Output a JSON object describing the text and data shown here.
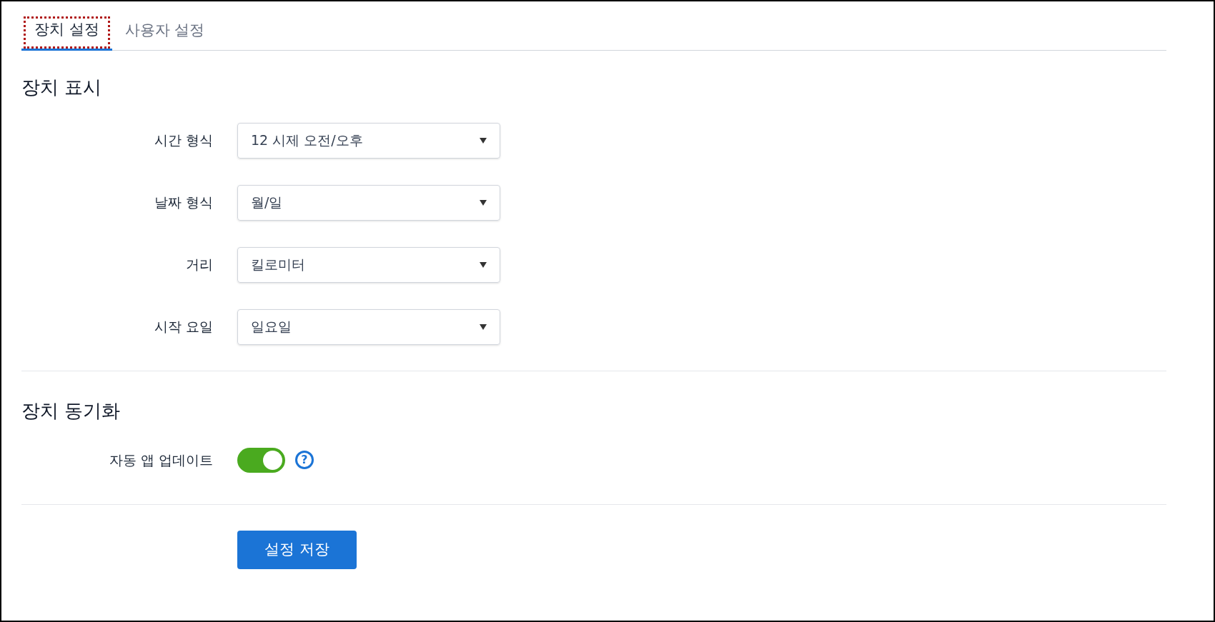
{
  "tabs": [
    {
      "label": "장치 설정",
      "selected": true
    },
    {
      "label": "사용자 설정",
      "selected": false
    }
  ],
  "display": {
    "heading": "장치 표시",
    "fields": [
      {
        "label": "시간 형식",
        "value": "12 시제 오전/오후"
      },
      {
        "label": "날짜 형식",
        "value": "월/일"
      },
      {
        "label": "거리",
        "value": "킬로미터"
      },
      {
        "label": "시작 요일",
        "value": "일요일"
      }
    ]
  },
  "sync": {
    "heading": "장치 동기화",
    "auto_update": {
      "label": "자동 앱 업데이트",
      "on": true,
      "help": "?"
    }
  },
  "save_button": "설정 저장"
}
